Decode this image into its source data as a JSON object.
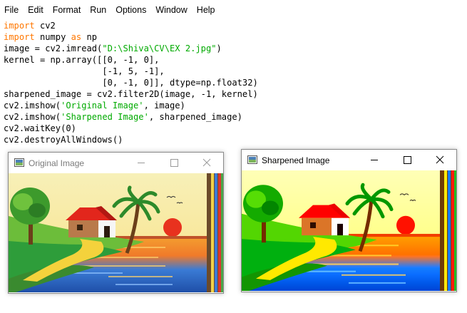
{
  "menu": [
    "File",
    "Edit",
    "Format",
    "Run",
    "Options",
    "Window",
    "Help"
  ],
  "code": [
    [
      {
        "t": "import",
        "c": "kw"
      },
      {
        "t": " cv2",
        "c": ""
      }
    ],
    [
      {
        "t": "import",
        "c": "kw"
      },
      {
        "t": " numpy ",
        "c": ""
      },
      {
        "t": "as",
        "c": "kw"
      },
      {
        "t": " np",
        "c": ""
      }
    ],
    [
      {
        "t": "image = cv2.imread(",
        "c": ""
      },
      {
        "t": "\"D:\\Shiva\\CV\\EX 2.jpg\"",
        "c": "st"
      },
      {
        "t": ")",
        "c": ""
      }
    ],
    [
      {
        "t": "kernel = np.array([[0, -1, 0],",
        "c": ""
      }
    ],
    [
      {
        "t": "                   [-1, 5, -1],",
        "c": ""
      }
    ],
    [
      {
        "t": "                   [0, -1, 0]], dtype=np.float32)",
        "c": ""
      }
    ],
    [
      {
        "t": "sharpened_image = cv2.filter2D(image, -1, kernel)",
        "c": ""
      }
    ],
    [
      {
        "t": "cv2.imshow(",
        "c": ""
      },
      {
        "t": "'Original Image'",
        "c": "st"
      },
      {
        "t": ", image)",
        "c": ""
      }
    ],
    [
      {
        "t": "cv2.imshow(",
        "c": ""
      },
      {
        "t": "'Sharpened Image'",
        "c": "st"
      },
      {
        "t": ", sharpened_image)",
        "c": ""
      }
    ],
    [
      {
        "t": "cv2.waitKey(0)",
        "c": ""
      }
    ],
    [
      {
        "t": "cv2.destroyAllWindows()",
        "c": ""
      }
    ]
  ],
  "windows": {
    "original": {
      "title": "Original Image"
    },
    "sharpened": {
      "title": "Sharpened Image"
    }
  },
  "colors": {
    "keyword": "#ff7700",
    "string": "#00aa00"
  }
}
